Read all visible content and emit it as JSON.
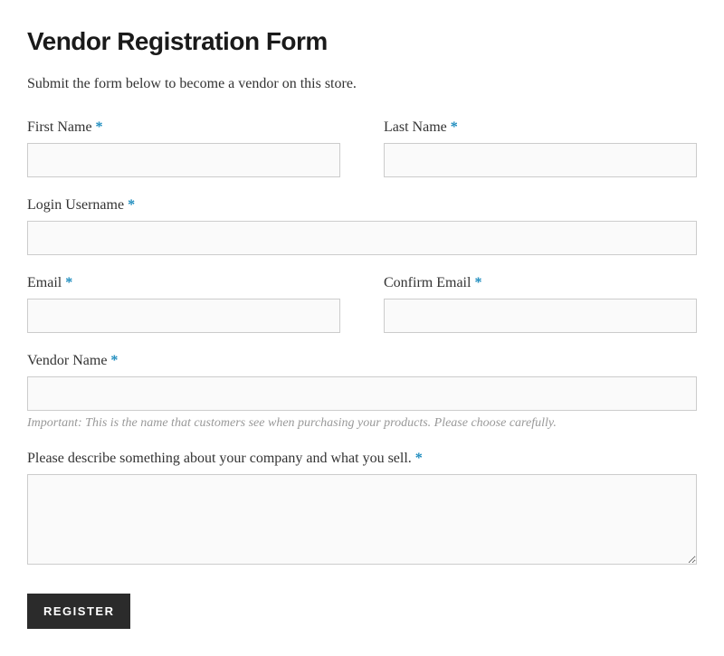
{
  "title": "Vendor Registration Form",
  "intro": "Submit the form below to become a vendor on this store.",
  "required_marker": "*",
  "fields": {
    "first_name": {
      "label": "First Name ",
      "value": ""
    },
    "last_name": {
      "label": "Last Name ",
      "value": ""
    },
    "login_username": {
      "label": "Login Username ",
      "value": ""
    },
    "email": {
      "label": "Email ",
      "value": ""
    },
    "confirm_email": {
      "label": "Confirm Email ",
      "value": ""
    },
    "vendor_name": {
      "label": "Vendor Name ",
      "value": "",
      "help": "Important: This is the name that customers see when purchasing your products. Please choose carefully."
    },
    "description": {
      "label": "Please describe something about your company and what you sell. ",
      "value": ""
    }
  },
  "submit_label": "Register"
}
